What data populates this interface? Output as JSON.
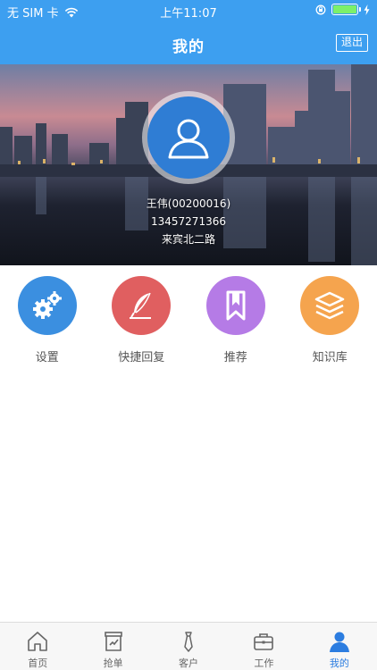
{
  "status_bar": {
    "carrier": "无 SIM 卡",
    "time": "上午11:07",
    "battery_level": 1.0
  },
  "header": {
    "title": "我的",
    "logout_label": "退出"
  },
  "profile": {
    "name_line": "王伟(00200016)",
    "phone": "13457271366",
    "address": "来宾北二路"
  },
  "functions": [
    {
      "label": "设置",
      "icon": "gears-icon",
      "color": "#3b8fe0"
    },
    {
      "label": "快捷回复",
      "icon": "feather-icon",
      "color": "#e05f60"
    },
    {
      "label": "推荐",
      "icon": "bookmark-icon",
      "color": "#b57be6"
    },
    {
      "label": "知识库",
      "icon": "layers-icon",
      "color": "#f5a44e"
    }
  ],
  "tabbar": {
    "items": [
      {
        "label": "首页",
        "icon": "home-icon",
        "active": false
      },
      {
        "label": "抢单",
        "icon": "grab-order-icon",
        "active": false
      },
      {
        "label": "客户",
        "icon": "tie-icon",
        "active": false
      },
      {
        "label": "工作",
        "icon": "briefcase-icon",
        "active": false
      },
      {
        "label": "我的",
        "icon": "person-icon",
        "active": true
      }
    ],
    "active_color": "#2c7de0"
  }
}
